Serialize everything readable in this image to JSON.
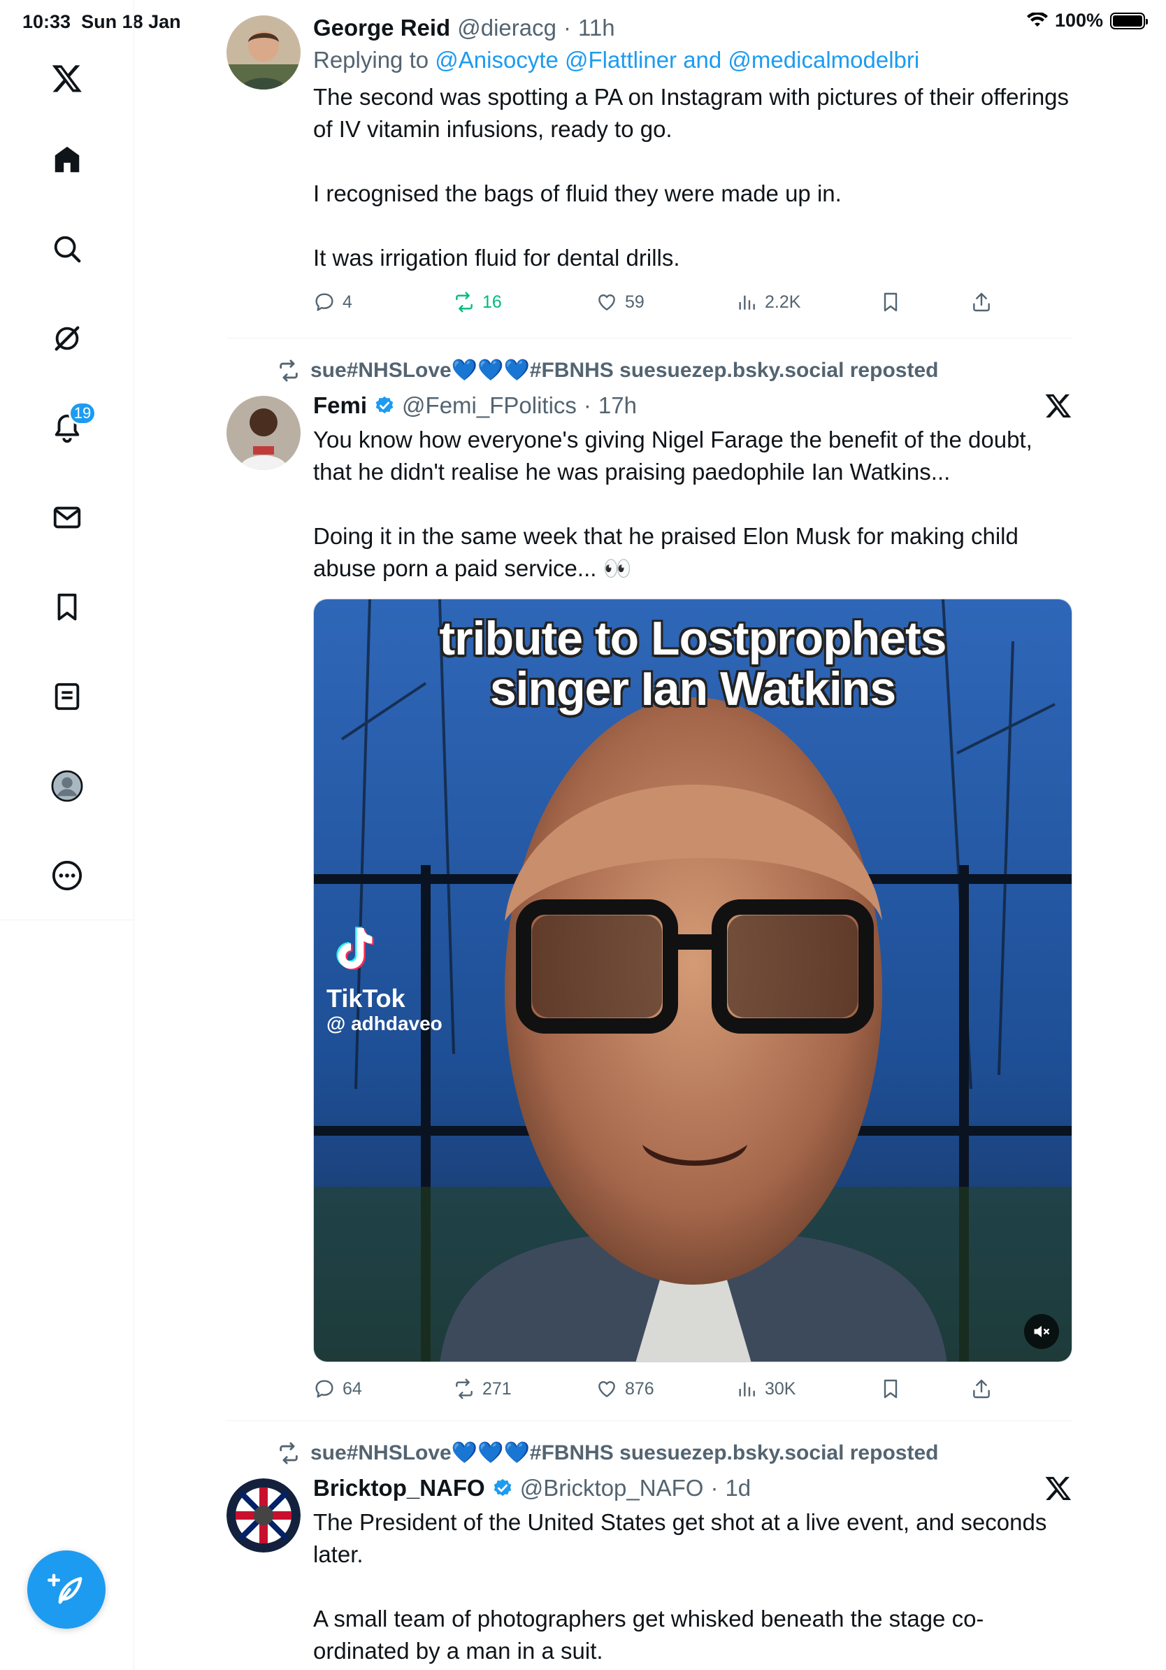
{
  "status_bar": {
    "time": "10:33",
    "date": "Sun 18 Jan",
    "battery": "100%"
  },
  "sidebar": {
    "items": [
      {
        "name": "x-logo-icon"
      },
      {
        "name": "home-icon"
      },
      {
        "name": "search-icon"
      },
      {
        "name": "grok-icon"
      },
      {
        "name": "notifications-icon",
        "badge": "19"
      },
      {
        "name": "messages-icon"
      },
      {
        "name": "bookmarks-icon"
      },
      {
        "name": "lists-icon"
      },
      {
        "name": "profile-icon"
      },
      {
        "name": "more-icon"
      }
    ]
  },
  "tweets": [
    {
      "name": "George Reid",
      "handle": "@dieracg",
      "time": "11h",
      "replying_prefix": "Replying to ",
      "replying_mentions": "@Anisocyte @Flattliner and @medicalmodelbri",
      "text": "The second was spotting a PA on Instagram with pictures of their offerings of IV vitamin infusions, ready to go.\n\nI recognised the bags of fluid they were made up in.\n\nIt was irrigation fluid for dental drills.",
      "replies": "4",
      "reposts": "16",
      "likes": "59",
      "views": "2.2K"
    },
    {
      "reposted_by": "sue#NHSLove💙💙💙#FBNHS suesuezep.bsky.social reposted",
      "name": "Femi",
      "handle": "@Femi_FPolitics",
      "time": "17h",
      "text": "You know how everyone's giving Nigel Farage the benefit of the doubt, that he didn't realise he was praising paedophile Ian Watkins...\n\nDoing it in the same week that he praised Elon Musk for making child abuse porn a paid service... 👀",
      "media": {
        "caption_line1": "tribute to Lostprophets",
        "caption_line2": "singer Ian Watkins",
        "watermark_brand": "TikTok",
        "watermark_user": "@ adhdaveo"
      },
      "replies": "64",
      "reposts": "271",
      "likes": "876",
      "views": "30K"
    },
    {
      "reposted_by": "sue#NHSLove💙💙💙#FBNHS suesuezep.bsky.social reposted",
      "name": "Bricktop_NAFO",
      "handle": "@Bricktop_NAFO",
      "time": "1d",
      "text": "The President of the United States get shot at a live event, and seconds later.\n\nA small team of photographers get whisked beneath the stage co-ordinated by a man in a suit."
    }
  ],
  "colors": {
    "accent": "#1d9bf0",
    "repost_green": "#00ba7c",
    "secondary_text": "#536471"
  }
}
